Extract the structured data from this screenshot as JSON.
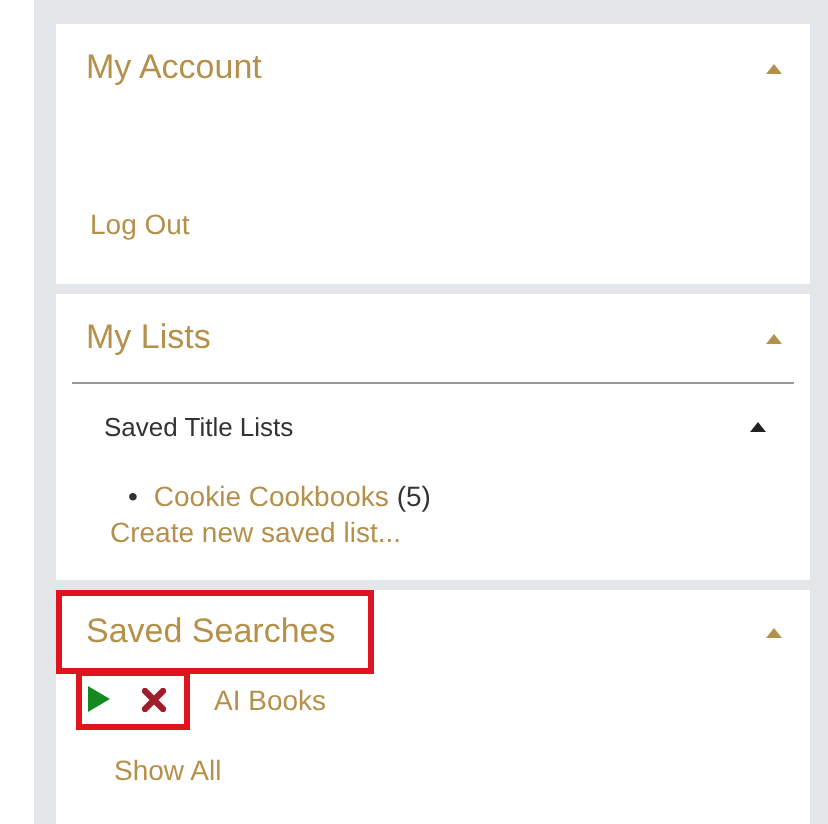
{
  "panels": [
    {
      "kind": "account",
      "title": "My Account",
      "expanded": true,
      "highlighted": false,
      "links": [
        "Log Out"
      ]
    },
    {
      "kind": "lists",
      "title": "My Lists",
      "expanded": true,
      "highlighted": false,
      "subsection": {
        "title": "Saved Title Lists",
        "expanded": true,
        "items": [
          {
            "marker": "•",
            "name": "Cookie Cookbooks",
            "count": "(5)"
          }
        ],
        "create_link": "Create new saved list..."
      }
    },
    {
      "kind": "searches",
      "title": "Saved Searches",
      "expanded": true,
      "highlighted": true,
      "searches": [
        {
          "name": "AI Books",
          "actions_highlighted": true
        }
      ],
      "links": [
        "Show All"
      ]
    }
  ]
}
